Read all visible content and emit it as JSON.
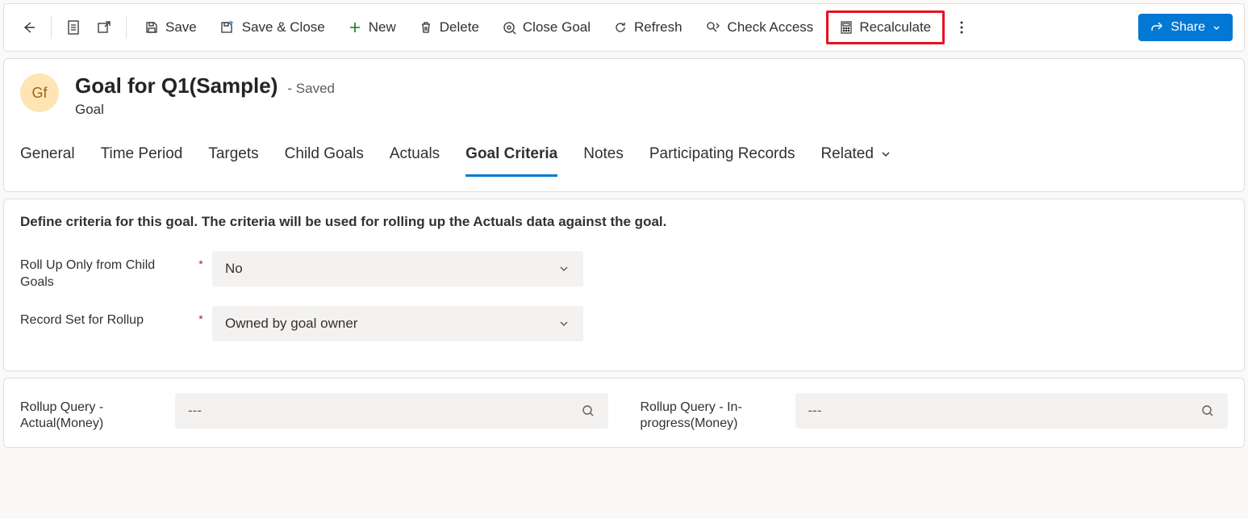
{
  "toolbar": {
    "save": "Save",
    "save_close": "Save & Close",
    "new": "New",
    "delete": "Delete",
    "close_goal": "Close Goal",
    "refresh": "Refresh",
    "check_access": "Check Access",
    "recalculate": "Recalculate",
    "share": "Share"
  },
  "header": {
    "avatar_initials": "Gf",
    "title": "Goal for Q1(Sample)",
    "saved_suffix": "- Saved",
    "subtitle": "Goal"
  },
  "tabs": {
    "general": "General",
    "time_period": "Time Period",
    "targets": "Targets",
    "child_goals": "Child Goals",
    "actuals": "Actuals",
    "goal_criteria": "Goal Criteria",
    "notes": "Notes",
    "participating_records": "Participating Records",
    "related": "Related"
  },
  "criteria": {
    "description": "Define criteria for this goal. The criteria will be used for rolling up the Actuals data against the goal.",
    "rollup_child_label": "Roll Up Only from Child Goals",
    "rollup_child_value": "No",
    "record_set_label": "Record Set for Rollup",
    "record_set_value": "Owned by goal owner"
  },
  "queries": {
    "actual_label": "Rollup Query - Actual(Money)",
    "actual_placeholder": "---",
    "inprogress_label": "Rollup Query - In-progress(Money)",
    "inprogress_placeholder": "---"
  }
}
